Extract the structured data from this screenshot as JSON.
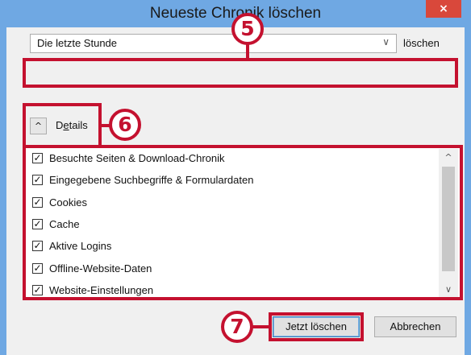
{
  "window": {
    "title": "Neueste Chronik löschen",
    "close_label": "×"
  },
  "range": {
    "selected": "Die letzte Stunde",
    "arrow": "∨",
    "action_label": "löschen"
  },
  "details": {
    "toggle_glyph": "^",
    "label_prefix": "D",
    "label_underlined": "e",
    "label_suffix": "tails"
  },
  "items": [
    {
      "label": "Besuchte Seiten & Download-Chronik",
      "checked": true
    },
    {
      "label": "Eingegebene Suchbegriffe & Formulardaten",
      "checked": true
    },
    {
      "label": "Cookies",
      "checked": true
    },
    {
      "label": "Cache",
      "checked": true
    },
    {
      "label": "Aktive Logins",
      "checked": true
    },
    {
      "label": "Offline-Website-Daten",
      "checked": true
    },
    {
      "label": "Website-Einstellungen",
      "checked": true
    }
  ],
  "check_glyph": "✓",
  "scroll": {
    "up": "^",
    "down": "∨"
  },
  "buttons": {
    "clear_now": "Jetzt löschen",
    "cancel": "Abbrechen"
  },
  "badges": {
    "b5": "5",
    "b6": "6",
    "b7": "7"
  },
  "colors": {
    "highlight": "#c4112f",
    "titlebar": "#6fa8e3",
    "close": "#d9483b"
  }
}
